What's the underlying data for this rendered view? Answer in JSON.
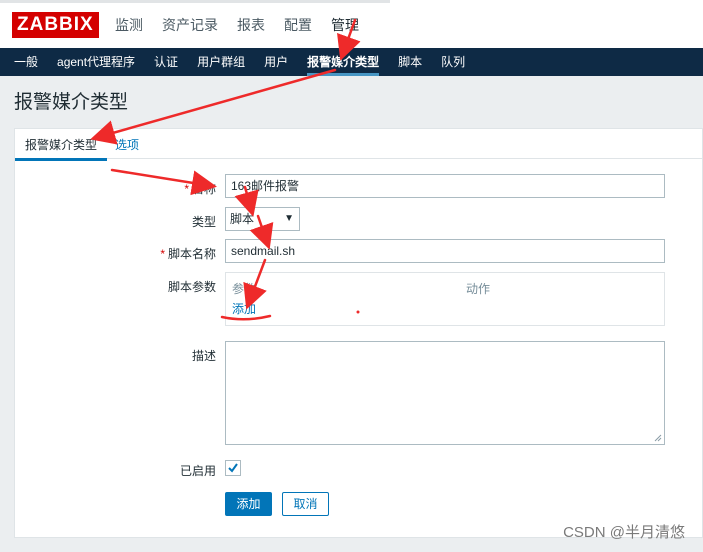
{
  "logo": "ZABBIX",
  "main_nav": [
    "监测",
    "资产记录",
    "报表",
    "配置",
    "管理"
  ],
  "sub_nav": [
    "一般",
    "agent代理程序",
    "认证",
    "用户群组",
    "用户",
    "报警媒介类型",
    "脚本",
    "队列"
  ],
  "page_title": "报警媒介类型",
  "tabs": [
    "报警媒介类型",
    "选项"
  ],
  "form": {
    "name_label": "名称",
    "name_value": "163邮件报警",
    "type_label": "类型",
    "type_value": "脚本",
    "script_name_label": "脚本名称",
    "script_name_value": "sendmail.sh",
    "script_params_label": "脚本参数",
    "params_col_param": "参数",
    "params_col_action": "动作",
    "add_link": "添加",
    "description_label": "描述",
    "enabled_label": "已启用",
    "enabled": true
  },
  "buttons": {
    "add": "添加",
    "cancel": "取消"
  },
  "watermark": "CSDN @半月清悠",
  "colors": {
    "logo_bg": "#d40000",
    "subnav_bg": "#0e2a45",
    "accent": "#0275b8",
    "annotation": "#ee2a2a"
  },
  "icons": [
    "chevron-down-icon",
    "checkmark-icon",
    "resize-handle-icon"
  ]
}
